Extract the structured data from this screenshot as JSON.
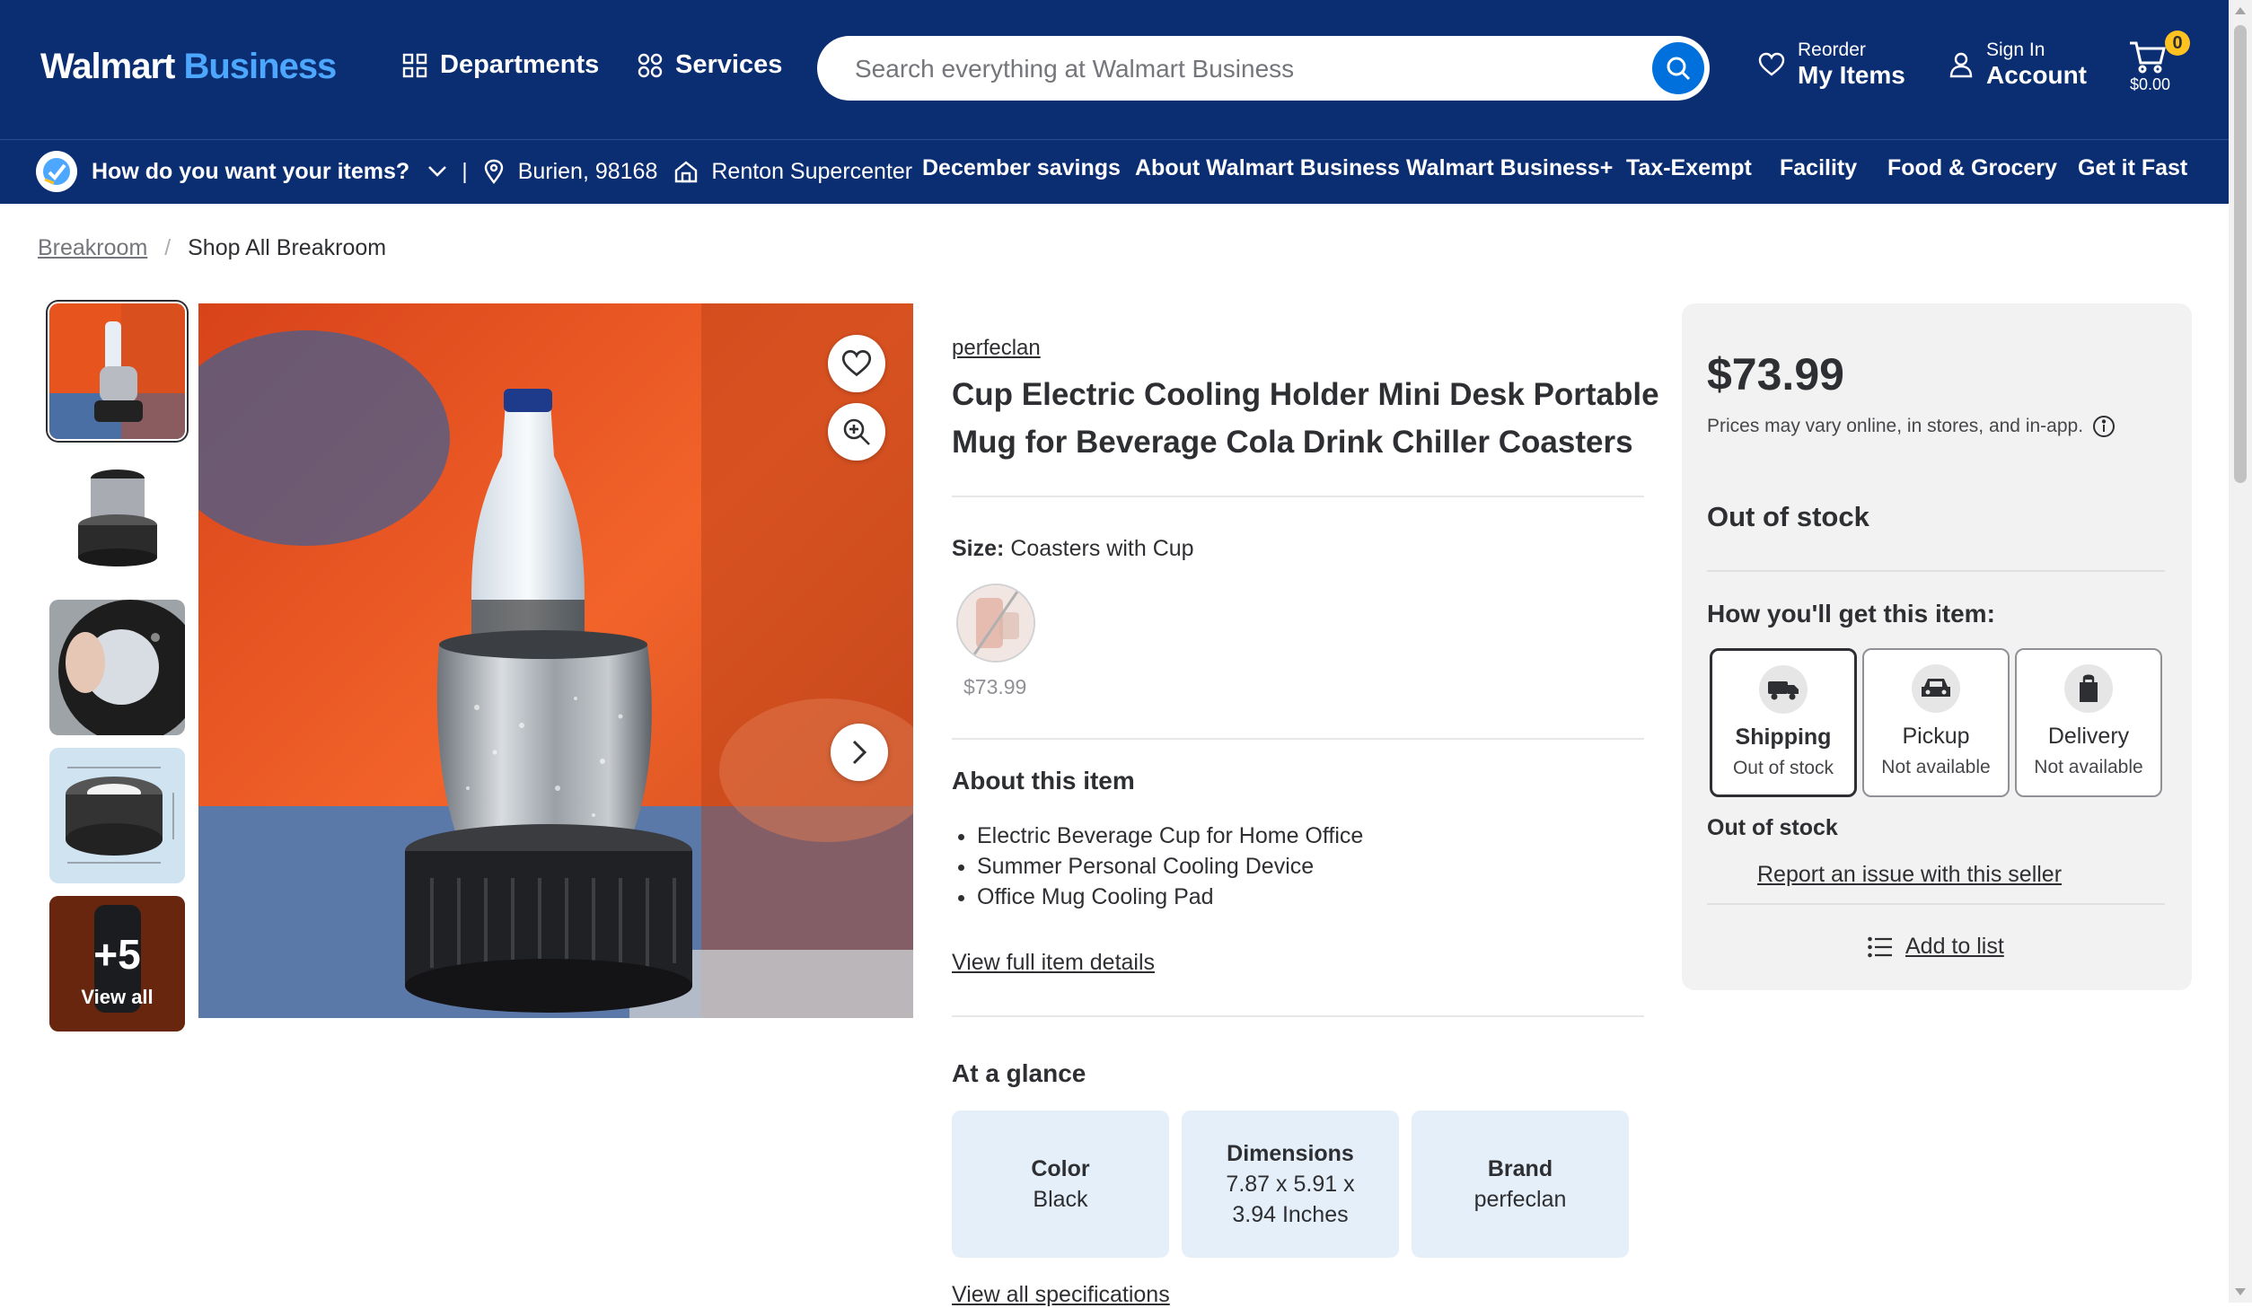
{
  "header": {
    "logo_main": "Walmart",
    "logo_accent": "Business",
    "departments": "Departments",
    "services": "Services",
    "search_placeholder": "Search everything at Walmart Business",
    "reorder_small": "Reorder",
    "reorder_big": "My Items",
    "signin_small": "Sign In",
    "signin_big": "Account",
    "cart_count": "0",
    "cart_total": "$0.00"
  },
  "subnav": {
    "fulfillment_prompt": "How do you want your items?",
    "divider": "|",
    "location": "Burien, 98168",
    "store": "Renton Supercenter",
    "links": [
      "December savings",
      "About Walmart Business",
      "Walmart Business+",
      "Tax-Exempt",
      "Facility",
      "Food & Grocery",
      "Get it Fast"
    ]
  },
  "breadcrumb": {
    "parent": "Breakroom",
    "separator": "/",
    "current": "Shop All Breakroom"
  },
  "gallery": {
    "more_count": "+5",
    "view_all": "View all"
  },
  "product": {
    "seller": "perfeclan",
    "title": "Cup Electric Cooling Holder Mini Desk Portable Mug for Beverage Cola Drink Chiller Coasters",
    "size_label": "Size:",
    "size_value": "Coasters with Cup",
    "swatch_price": "$73.99",
    "about_title": "About this item",
    "bullets": [
      "Electric Beverage Cup for Home Office",
      "Summer Personal Cooling Device",
      "Office Mug Cooling Pad"
    ],
    "view_details": "View full item details",
    "glance_title": "At a glance",
    "glance": [
      {
        "label": "Color",
        "value": "Black"
      },
      {
        "label": "Dimensions",
        "value": "7.87 x 5.91 x 3.94 Inches"
      },
      {
        "label": "Brand",
        "value": "perfeclan"
      }
    ],
    "view_specs": "View all specifications"
  },
  "buybox": {
    "price": "$73.99",
    "price_note": "Prices may vary online, in stores, and in-app.",
    "stock_status": "Out of stock",
    "how_title": "How you'll get this item:",
    "options": [
      {
        "name": "Shipping",
        "status": "Out of stock",
        "icon": "shipping-truck-icon"
      },
      {
        "name": "Pickup",
        "status": "Not available",
        "icon": "pickup-car-icon"
      },
      {
        "name": "Delivery",
        "status": "Not available",
        "icon": "delivery-bag-icon"
      }
    ],
    "stock_status_2": "Out of stock",
    "report_link": "Report an issue with this seller",
    "add_to_list": "Add to list"
  },
  "colors": {
    "header_bg": "#0b2e73",
    "brand_blue": "#0071dc",
    "logo_accent": "#4ea7ff",
    "cart_badge": "#ffc220",
    "glance_bg": "#e5effa"
  }
}
